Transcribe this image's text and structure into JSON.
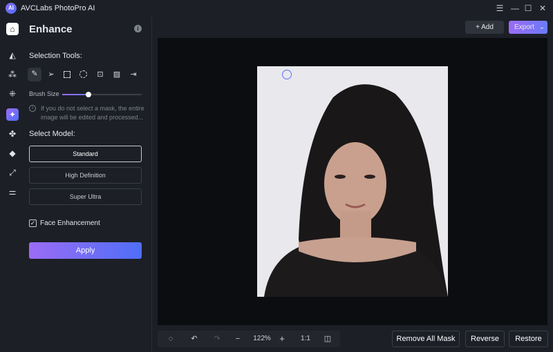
{
  "app": {
    "title": "AVCLabs PhotoPro AI",
    "logo_text": "AI"
  },
  "window": {
    "menu_icon": "☰",
    "minimize_icon": "—",
    "maximize_icon": "☐",
    "close_icon": "✕"
  },
  "header": {
    "add_label": "+ Add",
    "export_label": "Export",
    "export_chevron": "⌄"
  },
  "rail": {
    "items": [
      {
        "icon": "home-icon",
        "active": false
      },
      {
        "icon": "eraser-icon"
      },
      {
        "icon": "colorize-icon"
      },
      {
        "icon": "denoise-icon"
      },
      {
        "icon": "enhance-icon",
        "active": true
      },
      {
        "icon": "background-icon"
      },
      {
        "icon": "paint-bucket-icon"
      },
      {
        "icon": "upscale-icon"
      },
      {
        "icon": "adjust-icon"
      }
    ]
  },
  "panel": {
    "title": "Enhance",
    "info_icon": "i",
    "selection_tools_label": "Selection Tools:",
    "tools": [
      "brush",
      "pointer",
      "rectangle",
      "ellipse",
      "portrait",
      "background",
      "import"
    ],
    "brush_size_label": "Brush Size",
    "brush_size_percent": 33,
    "notice": "If you do not select a mask, the entire image will be edited and processed...",
    "select_model_label": "Select Model:",
    "models": [
      "Standard",
      "High Definition",
      "Super Ultra"
    ],
    "selected_model": "Standard",
    "face_enhancement_label": "Face Enhancement",
    "face_enhancement_checked": true,
    "apply_label": "Apply"
  },
  "toolbar": {
    "zoom": "122%",
    "one_to_one": "1:1",
    "zoom_out": "−",
    "zoom_in": "+"
  },
  "actions": {
    "remove_all_mask": "Remove All Mask",
    "reverse": "Reverse",
    "restore": "Restore"
  },
  "colors": {
    "accent_start": "#9b6cf6",
    "accent_end": "#4f6ef7"
  }
}
